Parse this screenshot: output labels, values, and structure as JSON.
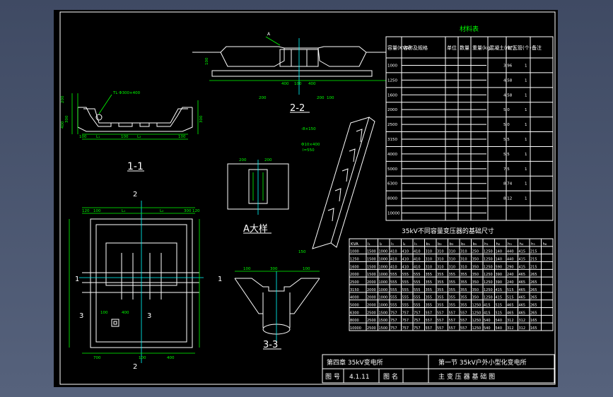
{
  "sheet": {
    "material_table": {
      "title": "材料表",
      "headers": [
        "容量(KVA)",
        "名称及规格",
        "单位",
        "数量",
        "重量(kg)",
        "混凝土(m³)",
        "缸瓦管(个)",
        "备注"
      ],
      "rows": [
        {
          "kva": "1000",
          "concrete": "3.96",
          "pipe": "1"
        },
        {
          "kva": "1250",
          "concrete": "4.58",
          "pipe": "1"
        },
        {
          "kva": "1600",
          "concrete": "4.58",
          "pipe": "1"
        },
        {
          "kva": "2000",
          "concrete": "5.0",
          "pipe": "1"
        },
        {
          "kva": "2500",
          "concrete": "5.0",
          "pipe": "1"
        },
        {
          "kva": "3150",
          "concrete": "5.5",
          "pipe": "1"
        },
        {
          "kva": "4000",
          "concrete": "5.5",
          "pipe": "1"
        },
        {
          "kva": "5000",
          "concrete": "7.5",
          "pipe": "1"
        },
        {
          "kva": "6300",
          "concrete": "8.74",
          "pipe": "1"
        },
        {
          "kva": "8000",
          "concrete": "8.12",
          "pipe": "1"
        },
        {
          "kva": "10000",
          "concrete": "",
          "pipe": ""
        }
      ]
    },
    "dims_table": {
      "title": "35kV不同容量变压器的基础尺寸",
      "headers": [
        "KVA",
        "l₁",
        "l₂",
        "l₃",
        "l₄",
        "l₅",
        "b₁",
        "b₂",
        "b₃",
        "b₄",
        "b₅",
        "h₁",
        "h₂",
        "h₃",
        "h₄",
        "h₅",
        "h₆"
      ],
      "rows": [
        [
          "1000",
          "1500",
          "1000",
          "410",
          "410",
          "410",
          "310",
          "310",
          "310",
          "310",
          "250",
          "1250",
          "140",
          "440",
          "415",
          "215"
        ],
        [
          "1250",
          "1500",
          "1000",
          "410",
          "410",
          "410",
          "310",
          "310",
          "310",
          "310",
          "350",
          "1250",
          "140",
          "440",
          "415",
          "215"
        ],
        [
          "1600",
          "1500",
          "1000",
          "410",
          "410",
          "410",
          "310",
          "310",
          "310",
          "310",
          "350",
          "1250",
          "590",
          "290",
          "415",
          "215"
        ],
        [
          "2000",
          "1500",
          "1000",
          "555",
          "555",
          "555",
          "355",
          "355",
          "355",
          "355",
          "350",
          "1250",
          "390",
          "240",
          "465",
          "265"
        ],
        [
          "2500",
          "2000",
          "1000",
          "555",
          "555",
          "555",
          "355",
          "355",
          "355",
          "355",
          "350",
          "1250",
          "390",
          "240",
          "465",
          "265"
        ],
        [
          "3150",
          "2000",
          "1000",
          "555",
          "555",
          "555",
          "355",
          "355",
          "355",
          "355",
          "350",
          "1250",
          "415",
          "515",
          "465",
          "265"
        ],
        [
          "4000",
          "2000",
          "1000",
          "555",
          "555",
          "555",
          "355",
          "355",
          "355",
          "355",
          "350",
          "1250",
          "415",
          "515",
          "465",
          "265"
        ],
        [
          "5000",
          "2000",
          "1000",
          "555",
          "555",
          "555",
          "355",
          "355",
          "355",
          "355",
          "1250",
          "415",
          "515",
          "465",
          "465",
          "265"
        ],
        [
          "6300",
          "2500",
          "1500",
          "757",
          "757",
          "757",
          "557",
          "557",
          "557",
          "557",
          "1250",
          "415",
          "515",
          "465",
          "465",
          "265"
        ],
        [
          "8000",
          "2500",
          "1500",
          "757",
          "757",
          "757",
          "557",
          "557",
          "557",
          "557",
          "1250",
          "540",
          "540",
          "312",
          "312",
          "165"
        ],
        [
          "10000",
          "2500",
          "1500",
          "757",
          "757",
          "757",
          "557",
          "557",
          "557",
          "557",
          "1250",
          "540",
          "540",
          "312",
          "312",
          "165"
        ]
      ]
    },
    "views": {
      "section_11": "1-1",
      "section_22": "2-2",
      "section_33": "3-3",
      "detail_a": "A大样",
      "mark_a": "A",
      "mark_1": "1",
      "mark_2": "2",
      "mark_3": "3"
    },
    "dim_labels": {
      "d100": "100",
      "d120": "120",
      "d150": "150",
      "d200": "200",
      "d250": "250",
      "d300": "300",
      "d400": "400",
      "d500": "500",
      "d700": "700",
      "l1": "L₁",
      "l2": "L₂",
      "pipe_note": "TL Φ300×400",
      "rebar1": "-8×150",
      "rebar2": "Φ10×400",
      "rebar3": "l=550"
    },
    "title_block": {
      "chapter": "第四章  35kV变电所",
      "section": "第一节  35kV户外小型化变电所",
      "drawing_no_label": "图  号",
      "drawing_no": "4.1.11",
      "drawing_name_label": "图  名",
      "drawing_name": "主 变 压 器 基 础 图"
    },
    "colors": {
      "background": "#000000",
      "drawing_white": "#ffffff",
      "dimension_green": "#00ff00",
      "center_cyan": "#00ffff",
      "viewport": "#4a5670"
    }
  }
}
